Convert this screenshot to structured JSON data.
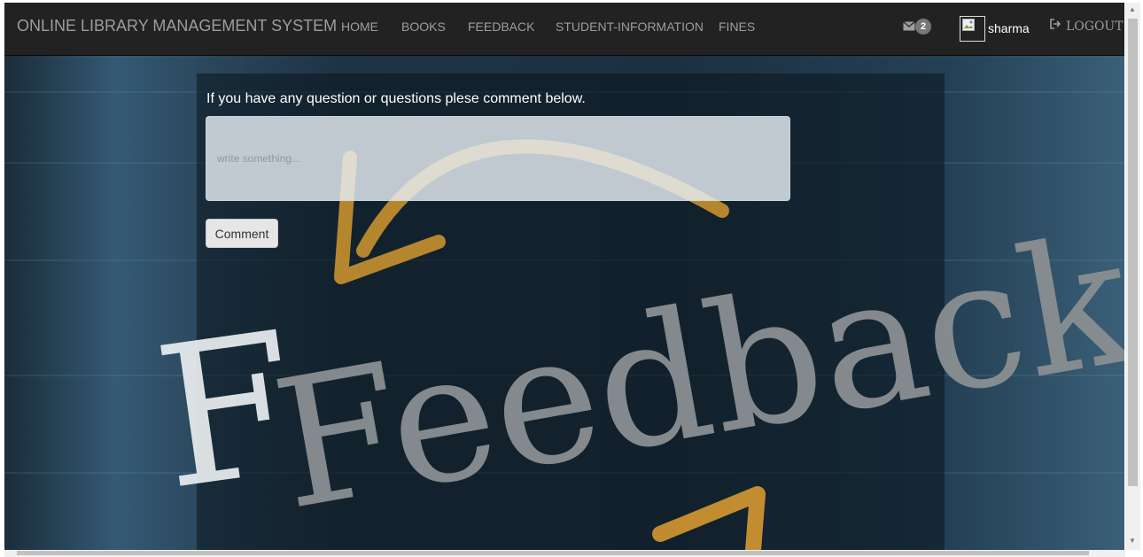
{
  "navbar": {
    "brand": "ONLINE LIBRARY MANAGEMENT SYSTEM",
    "links": [
      "HOME",
      "BOOKS",
      "FEEDBACK",
      "STUDENT-INFORMATION",
      "FINES"
    ],
    "message_count": "2",
    "username": "sharma",
    "logout_label": "LOGOUT"
  },
  "feedback": {
    "prompt": "If you have any question or questions plese comment below.",
    "placeholder": "write something...",
    "comment_button": "Comment",
    "background_word": "Feedback"
  },
  "colors": {
    "navbar_bg": "#222222",
    "nav_text": "#9d9d9d",
    "arrow_orange": "#f0a830"
  }
}
